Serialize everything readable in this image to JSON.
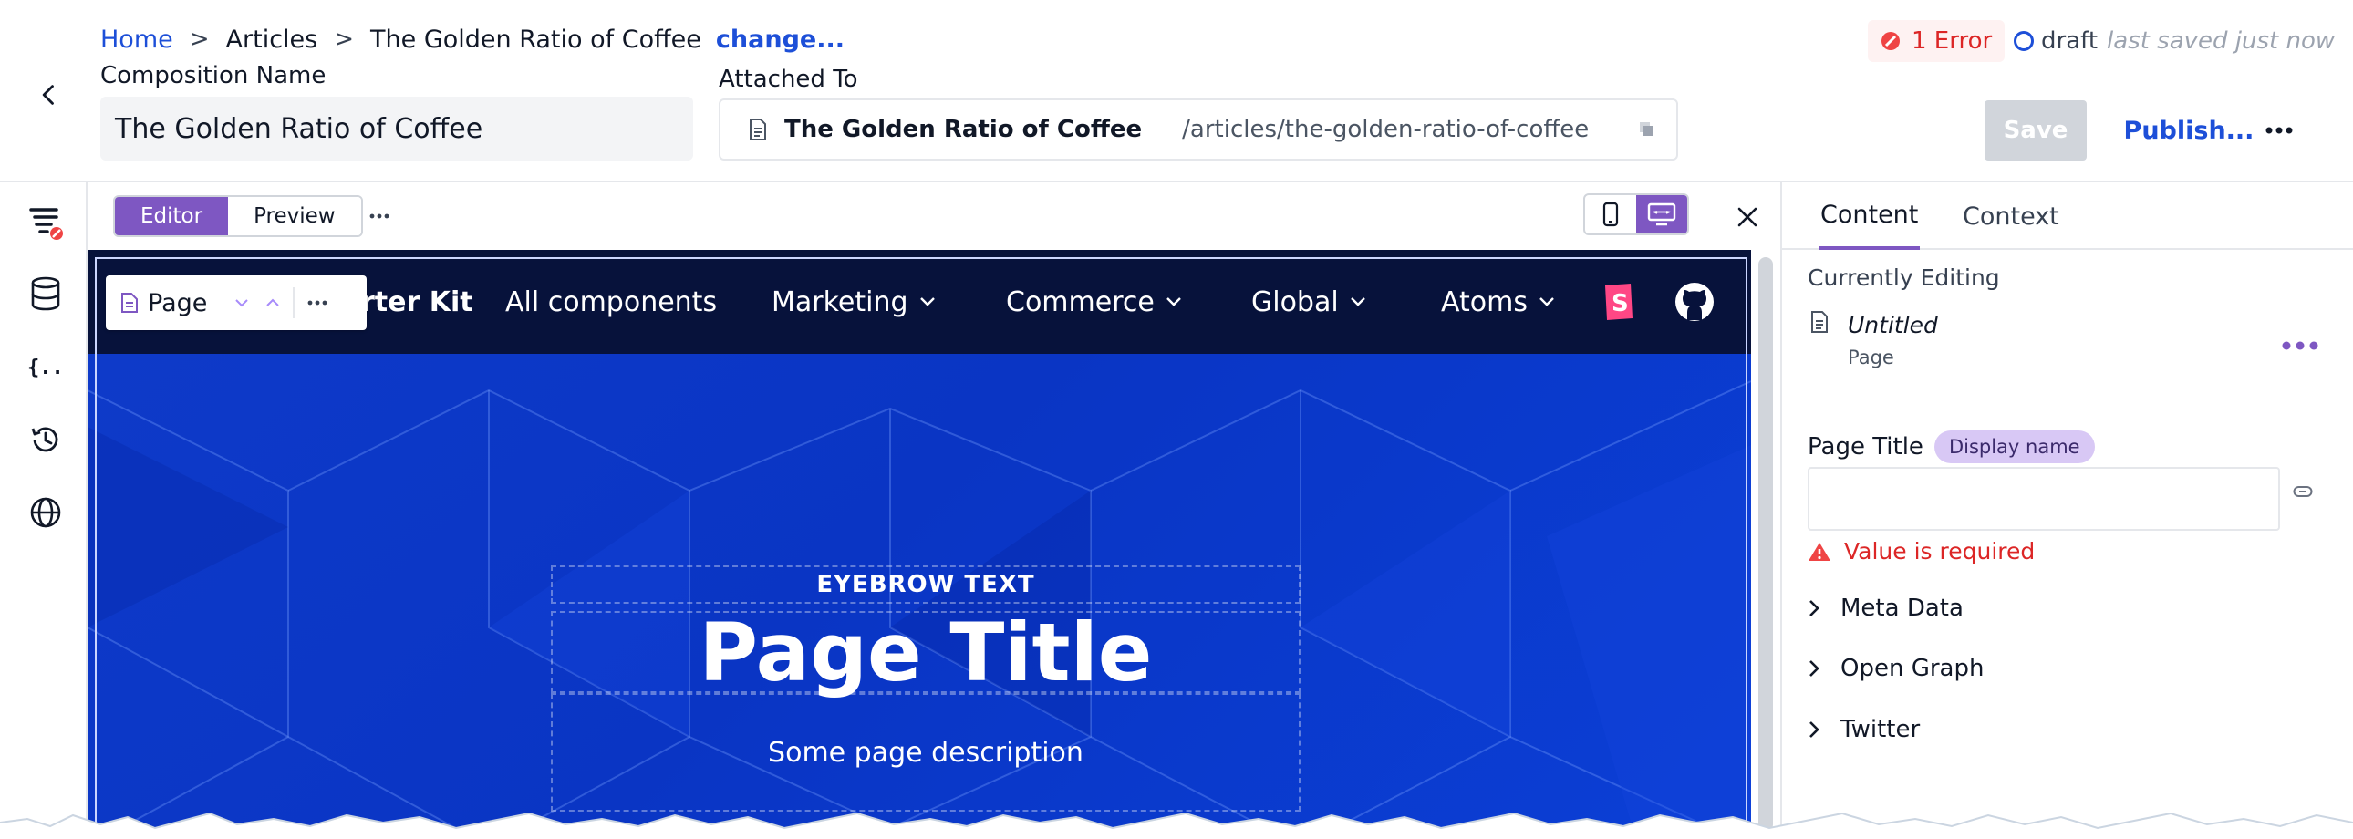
{
  "header": {
    "breadcrumbs": [
      "Home",
      "Articles",
      "The Golden Ratio of Coffee"
    ],
    "change_link": "change...",
    "error_badge": "1 Error",
    "status": "draft",
    "saved_text": "last saved just now",
    "composition_label": "Composition Name",
    "composition_value": "The Golden Ratio of Coffee",
    "attached_label": "Attached To",
    "attached_title": "The Golden Ratio of Coffee",
    "attached_path": "/articles/the-golden-ratio-of-coffee",
    "save_label": "Save",
    "publish_label": "Publish..."
  },
  "rail": {
    "icons": [
      "compositions-error-icon",
      "data-icon",
      "json-icon",
      "history-icon",
      "globe-icon"
    ]
  },
  "toolbar": {
    "tabs": [
      "Editor",
      "Preview"
    ],
    "active_tab": "Editor"
  },
  "site": {
    "brand": "rter Kit",
    "nav": [
      "All components",
      "Marketing",
      "Commerce",
      "Global",
      "Atoms"
    ],
    "chip_label": "Page",
    "eyebrow": "EYEBROW TEXT",
    "title": "Page Title",
    "description": "Some page description"
  },
  "panel": {
    "tabs": [
      "Content",
      "Context"
    ],
    "active_tab": "Content",
    "currently_editing_label": "Currently Editing",
    "editing_name": "Untitled",
    "editing_type": "Page",
    "page_title_label": "Page Title",
    "display_name_pill": "Display name",
    "page_title_value": "",
    "error_text": "Value is required",
    "sections": [
      "Meta Data",
      "Open Graph",
      "Twitter"
    ]
  },
  "colors": {
    "accent": "#7e57c2",
    "link": "#1d4fd8",
    "error": "#dc2626",
    "hero": "#0a39c6",
    "nav_bg": "#07123b"
  }
}
